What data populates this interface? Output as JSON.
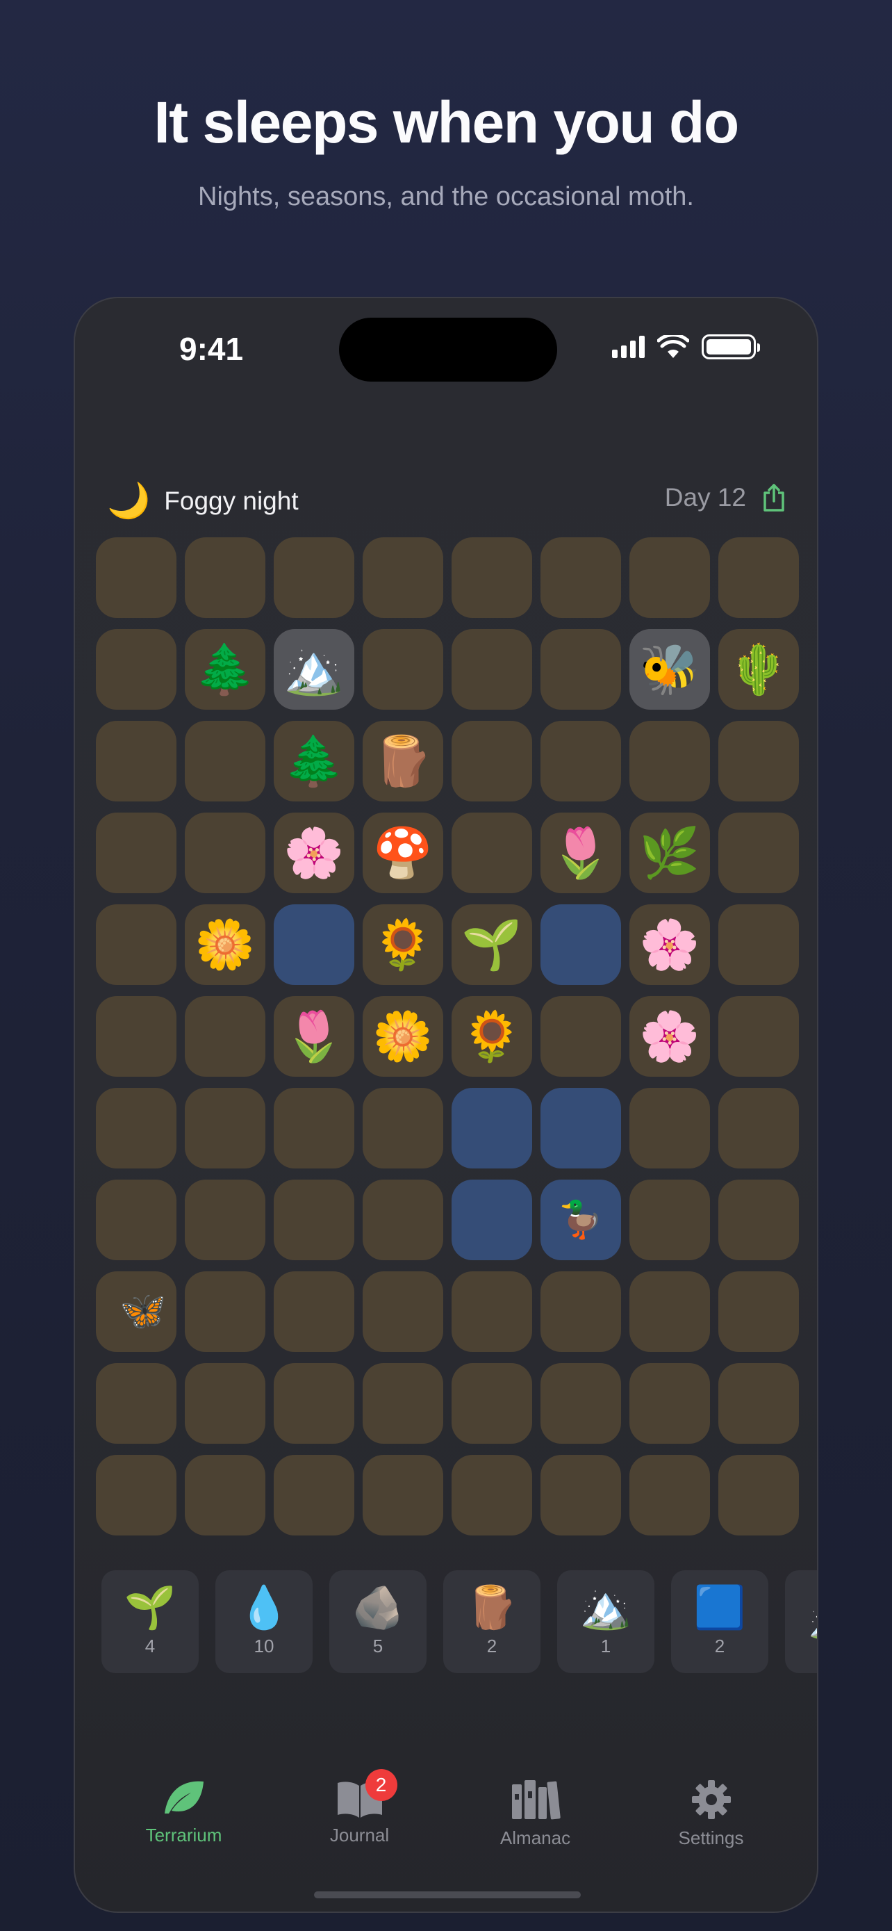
{
  "marketing": {
    "headline": "It sleeps when you do",
    "subhead": "Nights, seasons, and the occasional moth."
  },
  "status_bar": {
    "time": "9:41"
  },
  "header": {
    "weather_icon": "🌙",
    "weather_label": "Foggy night",
    "day_label": "Day 12",
    "share_icon": "share-icon",
    "accent_color": "#5fc37a"
  },
  "grid": {
    "columns": 8,
    "rows": [
      [
        {
          "t": "soil"
        },
        {
          "t": "soil"
        },
        {
          "t": "soil"
        },
        {
          "t": "soil"
        },
        {
          "t": "soil"
        },
        {
          "t": "soil"
        },
        {
          "t": "soil"
        },
        {
          "t": "soil"
        }
      ],
      [
        {
          "t": "soil"
        },
        {
          "t": "soil",
          "e": "🌲"
        },
        {
          "t": "stone",
          "e": "🏔️"
        },
        {
          "t": "soil"
        },
        {
          "t": "soil"
        },
        {
          "t": "soil"
        },
        {
          "t": "stone",
          "e": "🐝"
        },
        {
          "t": "soil",
          "e": "🌵"
        }
      ],
      [
        {
          "t": "soil"
        },
        {
          "t": "soil"
        },
        {
          "t": "soil",
          "e": "🌲"
        },
        {
          "t": "soil",
          "e": "🪵"
        },
        {
          "t": "soil"
        },
        {
          "t": "soil"
        },
        {
          "t": "soil"
        },
        {
          "t": "soil"
        }
      ],
      [
        {
          "t": "soil"
        },
        {
          "t": "soil"
        },
        {
          "t": "soil",
          "e": "🌸"
        },
        {
          "t": "soil",
          "e": "🍄"
        },
        {
          "t": "soil"
        },
        {
          "t": "soil",
          "e": "🌷"
        },
        {
          "t": "soil",
          "e": "🌿"
        },
        {
          "t": "soil"
        }
      ],
      [
        {
          "t": "soil"
        },
        {
          "t": "soil",
          "e": "🌼"
        },
        {
          "t": "water"
        },
        {
          "t": "soil",
          "e": "🌻"
        },
        {
          "t": "soil",
          "e": "🌱"
        },
        {
          "t": "water"
        },
        {
          "t": "soil",
          "e": "🌸"
        },
        {
          "t": "soil"
        }
      ],
      [
        {
          "t": "soil"
        },
        {
          "t": "soil"
        },
        {
          "t": "soil",
          "e": "🌷"
        },
        {
          "t": "soil",
          "e": "🌼"
        },
        {
          "t": "soil",
          "e": "🌻"
        },
        {
          "t": "soil"
        },
        {
          "t": "soil",
          "e": "🌸"
        },
        {
          "t": "soil"
        }
      ],
      [
        {
          "t": "soil"
        },
        {
          "t": "soil"
        },
        {
          "t": "soil"
        },
        {
          "t": "soil"
        },
        {
          "t": "water"
        },
        {
          "t": "water"
        },
        {
          "t": "soil"
        },
        {
          "t": "soil"
        }
      ],
      [
        {
          "t": "soil"
        },
        {
          "t": "soil"
        },
        {
          "t": "soil"
        },
        {
          "t": "soil"
        },
        {
          "t": "water"
        },
        {
          "t": "water",
          "e": "🦆",
          "s": "small"
        },
        {
          "t": "soil"
        },
        {
          "t": "soil"
        }
      ],
      [
        {
          "t": "soil",
          "e": "🦋",
          "s": "tiny"
        },
        {
          "t": "soil"
        },
        {
          "t": "soil"
        },
        {
          "t": "soil"
        },
        {
          "t": "soil"
        },
        {
          "t": "soil"
        },
        {
          "t": "soil"
        },
        {
          "t": "soil"
        }
      ],
      [
        {
          "t": "soil"
        },
        {
          "t": "soil"
        },
        {
          "t": "soil"
        },
        {
          "t": "soil"
        },
        {
          "t": "soil"
        },
        {
          "t": "soil"
        },
        {
          "t": "soil"
        },
        {
          "t": "soil"
        }
      ],
      [
        {
          "t": "soil"
        },
        {
          "t": "soil"
        },
        {
          "t": "soil"
        },
        {
          "t": "soil"
        },
        {
          "t": "soil"
        },
        {
          "t": "soil"
        },
        {
          "t": "soil"
        },
        {
          "t": "soil"
        }
      ]
    ]
  },
  "tray": {
    "items": [
      {
        "emoji": "🌱",
        "count": "4",
        "name": "sprout"
      },
      {
        "emoji": "💧",
        "count": "10",
        "name": "water"
      },
      {
        "emoji": "🪨",
        "count": "5",
        "name": "rock"
      },
      {
        "emoji": "🪵",
        "count": "2",
        "name": "log"
      },
      {
        "emoji": "🏔️",
        "count": "1",
        "name": "mountain"
      },
      {
        "emoji": "🟦",
        "count": "2",
        "name": "blue-square"
      },
      {
        "emoji": "🏔️",
        "count": "",
        "name": "partial"
      }
    ]
  },
  "tabs": [
    {
      "label": "Terrarium",
      "icon": "leaf-icon",
      "active": true
    },
    {
      "label": "Journal",
      "icon": "book-icon",
      "badge": "2"
    },
    {
      "label": "Almanac",
      "icon": "books-icon"
    },
    {
      "label": "Settings",
      "icon": "gear-icon"
    }
  ]
}
